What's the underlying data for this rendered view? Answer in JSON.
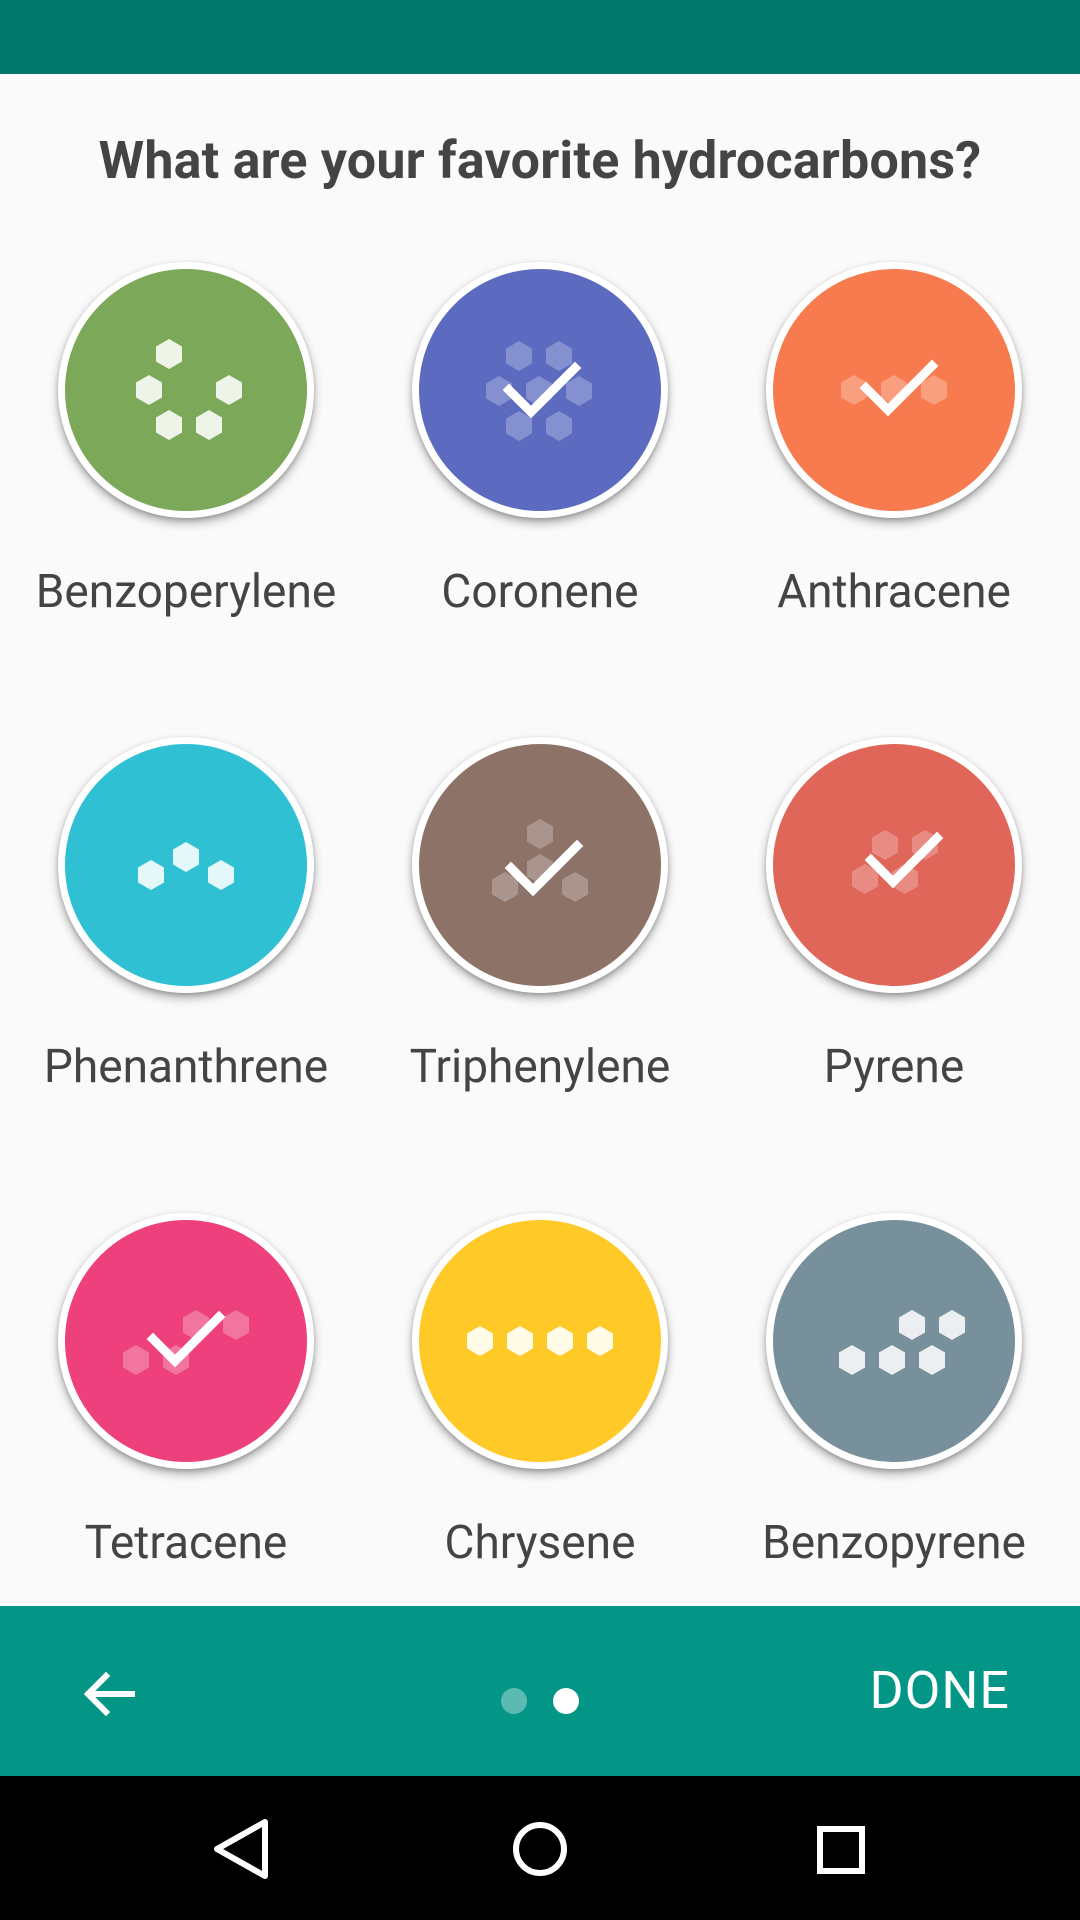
{
  "question": "What are your favorite hydrocarbons?",
  "items": [
    {
      "label": "Benzoperylene",
      "color": "#7ca859",
      "selected": false,
      "icon": "hexagon-cluster-icon"
    },
    {
      "label": "Coronene",
      "color": "#5c6bc0",
      "selected": true,
      "icon": "hexagon-cluster-icon"
    },
    {
      "label": "Anthracene",
      "color": "#f77b4f",
      "selected": true,
      "icon": "hexagon-cluster-icon"
    },
    {
      "label": "Phenanthrene",
      "color": "#2fc0d4",
      "selected": false,
      "icon": "hexagon-cluster-icon"
    },
    {
      "label": "Triphenylene",
      "color": "#8d7268",
      "selected": true,
      "icon": "hexagon-cluster-icon"
    },
    {
      "label": "Pyrene",
      "color": "#e0665a",
      "selected": true,
      "icon": "hexagon-cluster-icon"
    },
    {
      "label": "Tetracene",
      "color": "#ee407c",
      "selected": true,
      "icon": "hexagon-cluster-icon"
    },
    {
      "label": "Chrysene",
      "color": "#ffca28",
      "selected": false,
      "icon": "hexagon-cluster-icon"
    },
    {
      "label": "Benzopyrene",
      "color": "#78909c",
      "selected": false,
      "icon": "hexagon-cluster-icon"
    }
  ],
  "footer": {
    "back_icon": "arrow-back-icon",
    "done_label": "DONE",
    "page_count": 2,
    "current_page": 2
  },
  "nav": {
    "back_icon": "nav-back-triangle-icon",
    "home_icon": "nav-home-circle-icon",
    "recents_icon": "nav-recents-square-icon"
  },
  "colors": {
    "status_bar": "#00796b",
    "footer": "#039687",
    "background": "#fafafa"
  }
}
